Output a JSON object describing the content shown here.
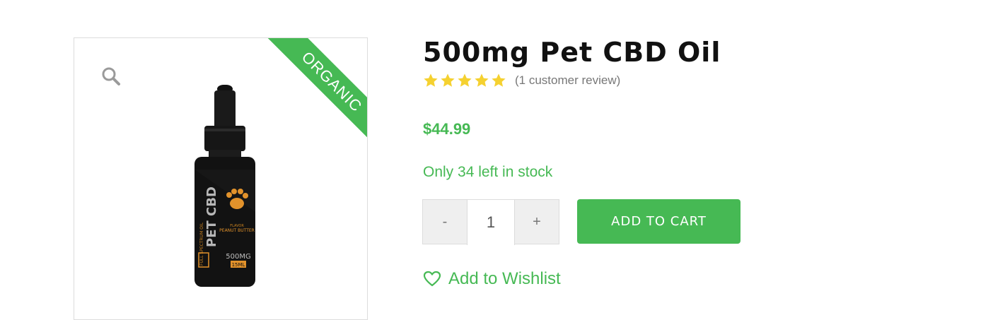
{
  "product": {
    "badge": "ORGANIC",
    "title": "500mg Pet CBD Oil",
    "rating": {
      "value": 5,
      "max": 5,
      "review_text": "(1 customer review)"
    },
    "price": "$44.99",
    "stock": "Only 34 left in stock",
    "quantity": {
      "minus_label": "-",
      "plus_label": "+",
      "value": "1"
    },
    "add_to_cart_label": "ADD TO CART",
    "wishlist_label": "Add to Wishlist",
    "label_text": {
      "brand": "PET CBD",
      "sub": "FULL SPECTRUM OIL",
      "flavor_label": "FLAVOR",
      "flavor": "PEANUT BUTTER",
      "strength": "500MG",
      "volume": "15ML"
    }
  },
  "colors": {
    "accent": "#46b954",
    "star": "#f5d130",
    "title": "#111111"
  },
  "icons": {
    "zoom": "magnifier-icon",
    "wishlist": "heart-icon",
    "rating": "star-icon"
  }
}
